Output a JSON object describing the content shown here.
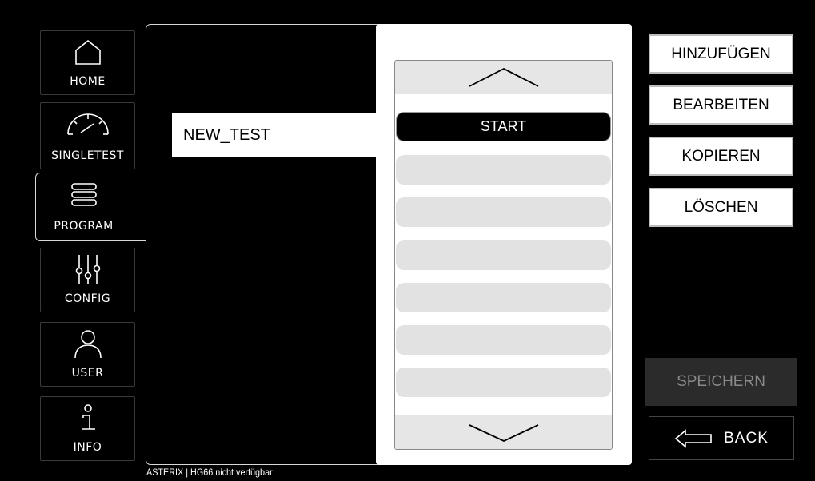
{
  "nav": {
    "items": [
      {
        "label": "HOME",
        "icon": "home-icon"
      },
      {
        "label": "SINGLETEST",
        "icon": "gauge-icon"
      },
      {
        "label": "PROGRAM",
        "icon": "program-list-icon"
      },
      {
        "label": "CONFIG",
        "icon": "sliders-icon"
      },
      {
        "label": "USER",
        "icon": "user-icon"
      },
      {
        "label": "INFO",
        "icon": "info-icon"
      }
    ],
    "active": "PROGRAM"
  },
  "program": {
    "name_value": "NEW_TEST"
  },
  "steps": {
    "items": [
      "START",
      "",
      "",
      "",
      "",
      "",
      ""
    ],
    "selected": "START"
  },
  "actions": {
    "add": "HINZUFÜGEN",
    "edit": "BEARBEITEN",
    "copy": "KOPIEREN",
    "delete": "LÖSCHEN",
    "save": "SPEICHERN",
    "back": "BACK"
  },
  "status_bar": {
    "text": "ASTERIX | HG66 nicht verfügbar"
  },
  "colors": {
    "background": "#000000",
    "panel": "#ffffff",
    "list_item": "#e2e2e2",
    "disabled_button": "#2b2b2b"
  }
}
